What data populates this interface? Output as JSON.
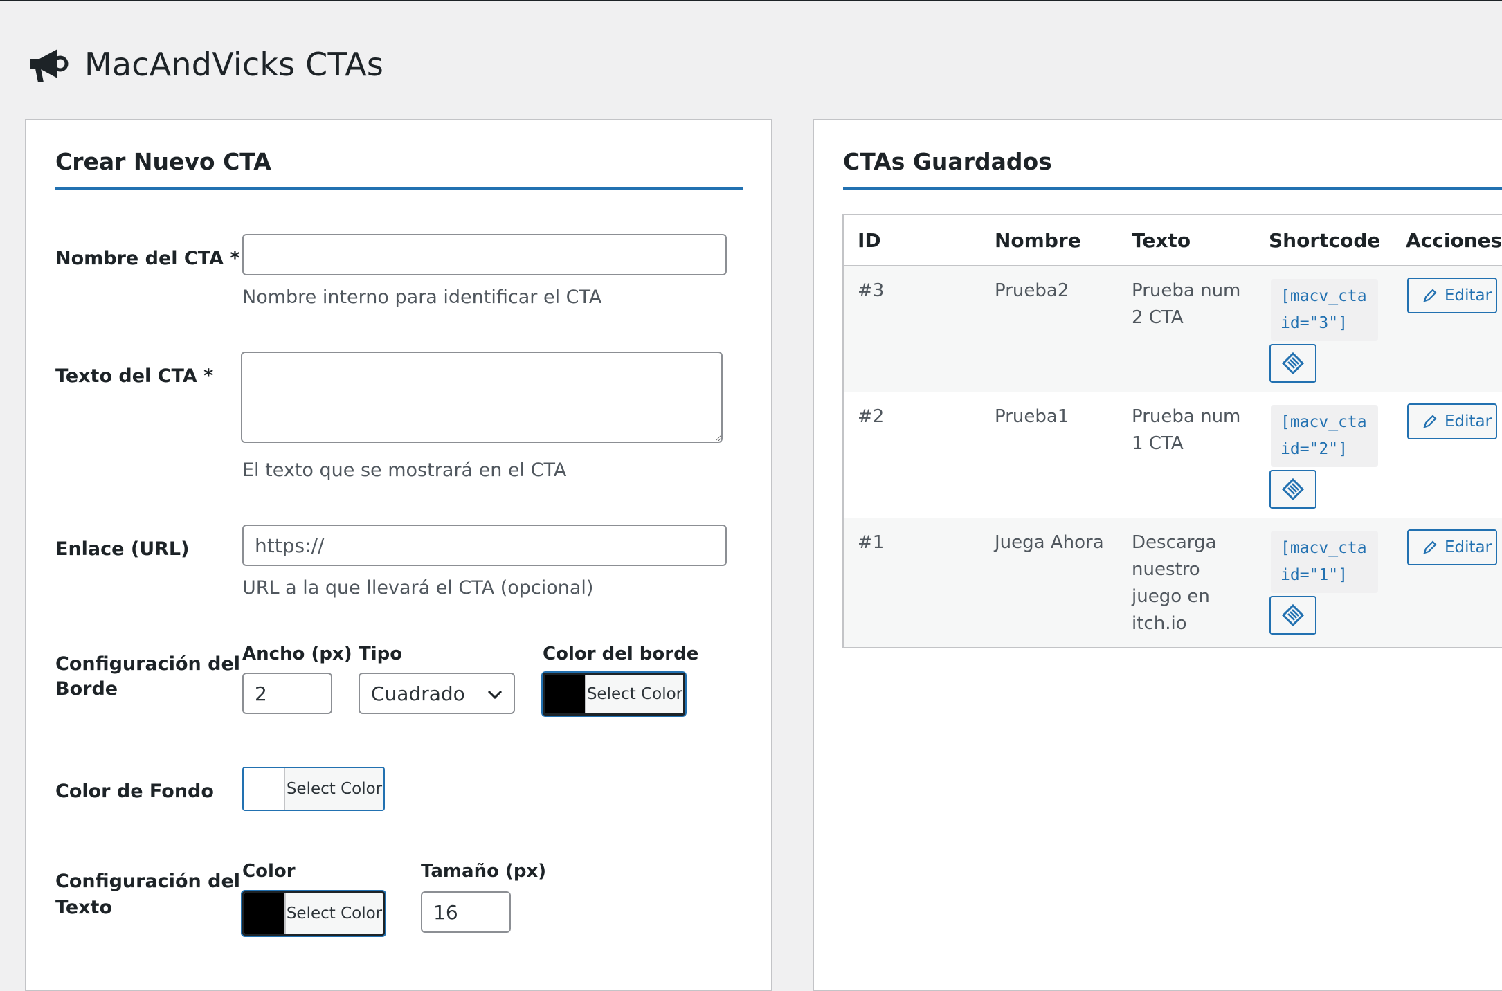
{
  "page": {
    "title": "MacAndVicks CTAs",
    "icon": "megaphone-icon"
  },
  "create_panel": {
    "heading": "Crear Nuevo CTA",
    "name_field": {
      "label": "Nombre del CTA *",
      "value": "",
      "help": "Nombre interno para identificar el CTA"
    },
    "text_field": {
      "label": "Texto del CTA *",
      "value": "",
      "help": "El texto que se mostrará en el CTA"
    },
    "url_field": {
      "label": "Enlace (URL)",
      "placeholder": "https://",
      "help": "URL a la que llevará el CTA (opcional)"
    },
    "border_config": {
      "label_line1": "Configuración del",
      "label_line2": "Borde",
      "width_label": "Ancho (px)",
      "width_value": "2",
      "type_label": "Tipo",
      "type_value": "Cuadrado",
      "color_label": "Color del borde",
      "color_button": "Select Color",
      "color": "#000000"
    },
    "background": {
      "label": "Color de Fondo",
      "color_button": "Select Color",
      "color": "#ffffff"
    },
    "text_config": {
      "label_line1": "Configuración del",
      "label_line2": "Texto",
      "color_label": "Color",
      "color_button": "Select Color",
      "color": "#000000",
      "size_label": "Tamaño (px)",
      "size_value": "16"
    }
  },
  "saved_panel": {
    "heading": "CTAs Guardados",
    "columns": [
      "ID",
      "Nombre",
      "Texto",
      "Shortcode",
      "Acciones"
    ],
    "rows": [
      {
        "id": "#3",
        "name": "Prueba2",
        "text_l1": "Prueba num",
        "text_l2": "2 CTA",
        "text_l3": "",
        "text_l4": "",
        "code_l1": "[macv_cta",
        "code_l2": "id=\"3\"]",
        "edit": "Editar"
      },
      {
        "id": "#2",
        "name": "Prueba1",
        "text_l1": "Prueba num",
        "text_l2": "1 CTA",
        "text_l3": "",
        "text_l4": "",
        "code_l1": "[macv_cta",
        "code_l2": "id=\"2\"]",
        "edit": "Editar"
      },
      {
        "id": "#1",
        "name": "Juega Ahora",
        "text_l1": "Descarga",
        "text_l2": "nuestro",
        "text_l3": "juego en",
        "text_l4": "itch.io",
        "code_l1": "[macv_cta",
        "code_l2": "id=\"1\"]",
        "edit": "Editar"
      }
    ]
  },
  "colors": {
    "accent": "#2271b1",
    "border": "#c3c4c7",
    "background": "#f0f0f1",
    "text": "#1d2327"
  }
}
